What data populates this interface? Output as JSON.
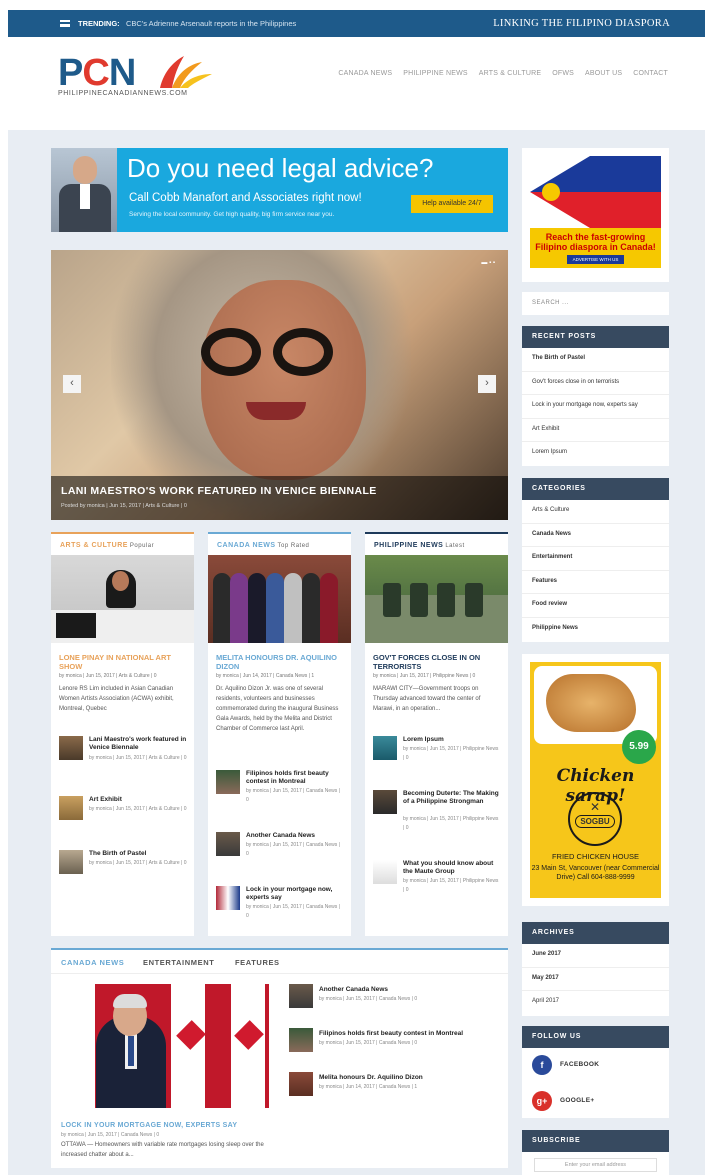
{
  "topbar": {
    "trending_label": "TRENDING:",
    "trending_text": "CBC's Adrienne Arsenault reports in the Philippines",
    "tagline": "LINKING THE FILIPINO DIASPORA"
  },
  "logo": {
    "p": "P",
    "c": "C",
    "n": "N",
    "sub": "PHILIPPINECANADIANNEWS.COM"
  },
  "nav": [
    "CANADA NEWS",
    "PHILIPPINE NEWS",
    "ARTS & CULTURE",
    "OFWS",
    "ABOUT US",
    "CONTACT"
  ],
  "ad_legal": {
    "headline": "Do you need legal advice?",
    "sub": "Call Cobb Manafort and Associates right now!",
    "tiny": "Serving the local community. Get high quality, big firm service near you.",
    "button": "Help available 24/7"
  },
  "side_ad": {
    "reach": "Reach the fast-growing Filipino diaspora in Canada!",
    "button": "ADVERTISE WITH US"
  },
  "slider": {
    "title": "LANI MAESTRO'S WORK FEATURED IN VENICE BIENNALE",
    "meta": "Posted by monica | Jun 15, 2017 | Arts & Culture | 0",
    "prev": "‹",
    "next": "›",
    "dots": "▬ ▪ ▪"
  },
  "col1": {
    "header": "ARTS & CULTURE",
    "tag": "Popular",
    "title": "LONE PINAY IN NATIONAL ART SHOW",
    "meta": "by monica | Jun 15, 2017 | Arts & Culture | 0",
    "excerpt": "Lenore RS Lim included in Asian Canadian Women Artists Association (ACWA) exhibit, Montreal, Quebec",
    "items": [
      {
        "title": "Lani Maestro's work featured in Venice Biennale",
        "meta": "by monica | Jun 15, 2017 | Arts & Culture | 0"
      },
      {
        "title": "Art Exhibit",
        "meta": "by monica | Jun 15, 2017 | Arts & Culture | 0"
      },
      {
        "title": "The Birth of Pastel",
        "meta": "by monica | Jun 15, 2017 | Arts & Culture | 0"
      }
    ]
  },
  "col2": {
    "header": "CANADA NEWS",
    "tag": "Top Rated",
    "title": "MELITA HONOURS DR. AQUILINO DIZON",
    "meta": "by monica | Jun 14, 2017 | Canada News | 1",
    "excerpt": "Dr. Aquilino Dizon Jr. was one of several residents, volunteers and businesses commemorated during the inaugural Business Gala Awards, held by the Melita and District Chamber of Commerce last April.",
    "items": [
      {
        "title": "Filipinos holds first beauty contest in Montreal",
        "meta": "by monica | Jun 15, 2017 | Canada News | 0"
      },
      {
        "title": "Another Canada News",
        "meta": "by monica | Jun 15, 2017 | Canada News | 0"
      },
      {
        "title": "Lock in your mortgage now, experts say",
        "meta": "by monica | Jun 15, 2017 | Canada News | 0"
      }
    ]
  },
  "col3": {
    "header": "PHILIPPINE NEWS",
    "tag": "Latest",
    "title": "GOV'T FORCES CLOSE IN ON TERRORISTS",
    "meta": "by monica | Jun 15, 2017 | Philippine News | 0",
    "excerpt": "MARAWI CITY—Government troops on Thursday advanced toward the center of Marawi, in an operation...",
    "items": [
      {
        "title": "Lorem Ipsum",
        "meta": "by monica | Jun 15, 2017 | Philippine News | 0"
      },
      {
        "title": "Becoming Duterte: The Making of a Philippine Strongman",
        "meta": "by monica | Jun 15, 2017 | Philippine News | 0"
      },
      {
        "title": "What you should know about the Maute Group",
        "meta": "by monica | Jun 15, 2017 | Philippine News | 0"
      }
    ]
  },
  "tabs": {
    "labels": [
      "CANADA NEWS",
      "ENTERTAINMENT",
      "FEATURES"
    ],
    "lead_title": "LOCK IN YOUR MORTGAGE NOW, EXPERTS SAY",
    "lead_meta": "by monica | Jun 15, 2017 | Canada News | 0",
    "lead_excerpt": "OTTAWA — Homeowners with variable rate mortgages losing sleep over the increased chatter about a...",
    "items": [
      {
        "title": "Another Canada News",
        "meta": "by monica | Jun 15, 2017 | Canada News | 0"
      },
      {
        "title": "Filipinos holds first beauty contest in Montreal",
        "meta": "by monica | Jun 15, 2017 | Canada News | 0"
      },
      {
        "title": "Melita honours Dr. Aquilino Dizon",
        "meta": "by monica | Jun 14, 2017 | Canada News | 1"
      }
    ]
  },
  "search": {
    "placeholder": "SEARCH ..."
  },
  "recent": {
    "header": "RECENT POSTS",
    "items": [
      "The Birth of Pastel",
      "Gov't forces close in on terrorists",
      "Lock in your mortgage now, experts say",
      "Art Exhibit",
      "Lorem Ipsum"
    ]
  },
  "categories": {
    "header": "CATEGORIES",
    "items": [
      "Arts & Culture",
      "Canada News",
      "Entertainment",
      "Features",
      "Food review",
      "Philippine News"
    ]
  },
  "chicken_ad": {
    "price": "5.99",
    "headline": "Chicken sarap!",
    "brand": "SOGBU",
    "place": "FRIED CHICKEN HOUSE",
    "address": "23 Main St, Vancouver (near Commercial Drive) Call 604-888-9999"
  },
  "archives": {
    "header": "ARCHIVES",
    "items": [
      "June 2017",
      "May 2017",
      "April 2017"
    ]
  },
  "follow": {
    "header": "FOLLOW US",
    "facebook": "FACEBOOK",
    "google": "GOOGLE+",
    "facebook_glyph": "f",
    "google_glyph": "g+"
  },
  "subscribe": {
    "header": "SUBSCRIBE",
    "placeholder": "Enter your email address"
  },
  "colors": {
    "brand_blue": "#1e5a8a",
    "arts": "#e8a25a",
    "canada": "#6aa9d4",
    "phil": "#1e3a5a",
    "widget_header": "#374a60"
  }
}
